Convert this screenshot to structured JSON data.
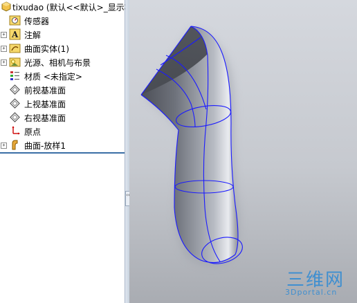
{
  "tree": {
    "title": "tixudao (默认<<默认>_显示状",
    "items": [
      {
        "label": "传感器",
        "icon": "sensor-folder-icon",
        "expander": ""
      },
      {
        "label": "注解",
        "icon": "annotation-icon",
        "expander": "+"
      },
      {
        "label": "曲面实体(1)",
        "icon": "surface-bodies-folder-icon",
        "expander": "+"
      },
      {
        "label": "光源、相机与布景",
        "icon": "lights-cameras-scenery-icon",
        "expander": "+"
      },
      {
        "label": "材质 <未指定>",
        "icon": "material-icon",
        "expander": ""
      },
      {
        "label": "前视基准面",
        "icon": "plane-icon",
        "expander": ""
      },
      {
        "label": "上视基准面",
        "icon": "plane-icon",
        "expander": ""
      },
      {
        "label": "右视基准面",
        "icon": "plane-icon",
        "expander": ""
      },
      {
        "label": "原点",
        "icon": "origin-icon",
        "expander": ""
      },
      {
        "label": "曲面-放样1",
        "icon": "surface-loft-icon",
        "expander": "+"
      }
    ]
  },
  "splitter": {
    "collapse_glyph": "‹‹"
  },
  "viewport": {
    "model": "lofted surface (curved tube)",
    "edge_color": "#1a1aff"
  },
  "watermark": {
    "logo_text": "三维网",
    "url_text": "3Dportal.cn"
  }
}
